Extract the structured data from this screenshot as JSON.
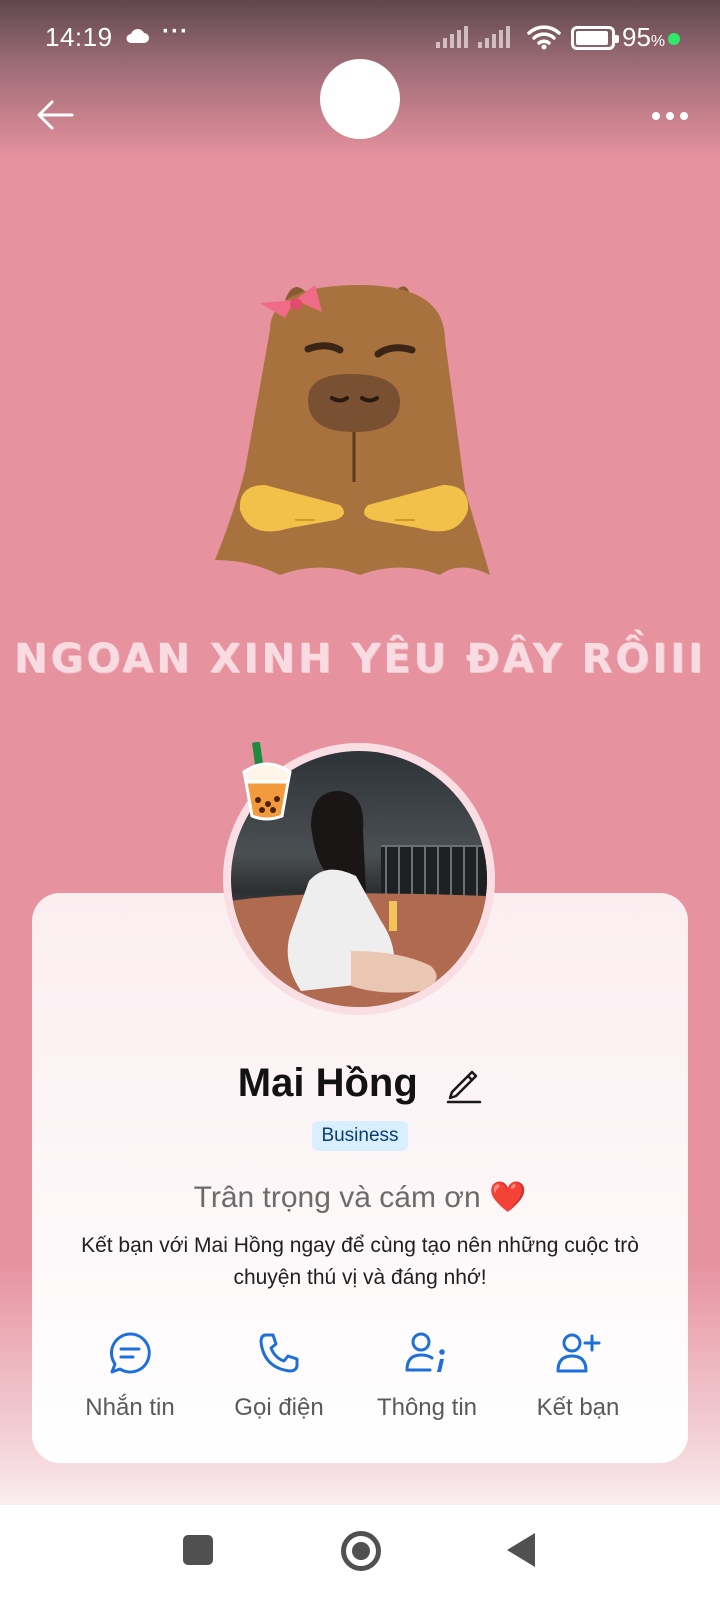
{
  "status_bar": {
    "time": "14:19",
    "battery_percent": "95",
    "battery_unit": "%",
    "battery_level": 0.95,
    "icons": [
      "cloud-icon",
      "more-dots-icon",
      "signal-icon",
      "signal-icon",
      "wifi-icon",
      "battery-icon"
    ]
  },
  "header": {
    "back_icon": "arrow-left-icon",
    "more_icon": "more-horizontal-icon"
  },
  "cover": {
    "caption": "NGOAN XINH YÊU ĐÂY RỒIII",
    "illustration": "capybara-illustration"
  },
  "profile": {
    "name": "Mai Hồng",
    "badge": "Business",
    "status": "Trân trọng và cám ơn",
    "status_emoji": "❤️",
    "bio": "Kết bạn với Mai Hồng ngay để cùng tạo nên những cuộc trò chuyện thú vị và đáng nhớ!"
  },
  "actions": [
    {
      "label": "Nhắn tin",
      "icon": "message-icon"
    },
    {
      "label": "Gọi điện",
      "icon": "phone-icon"
    },
    {
      "label": "Thông tin",
      "icon": "user-info-icon"
    },
    {
      "label": "Kết bạn",
      "icon": "add-friend-icon"
    }
  ],
  "colors": {
    "background": "#e7929f",
    "accent": "#1e6fd9",
    "badge_bg": "#d9efff"
  }
}
